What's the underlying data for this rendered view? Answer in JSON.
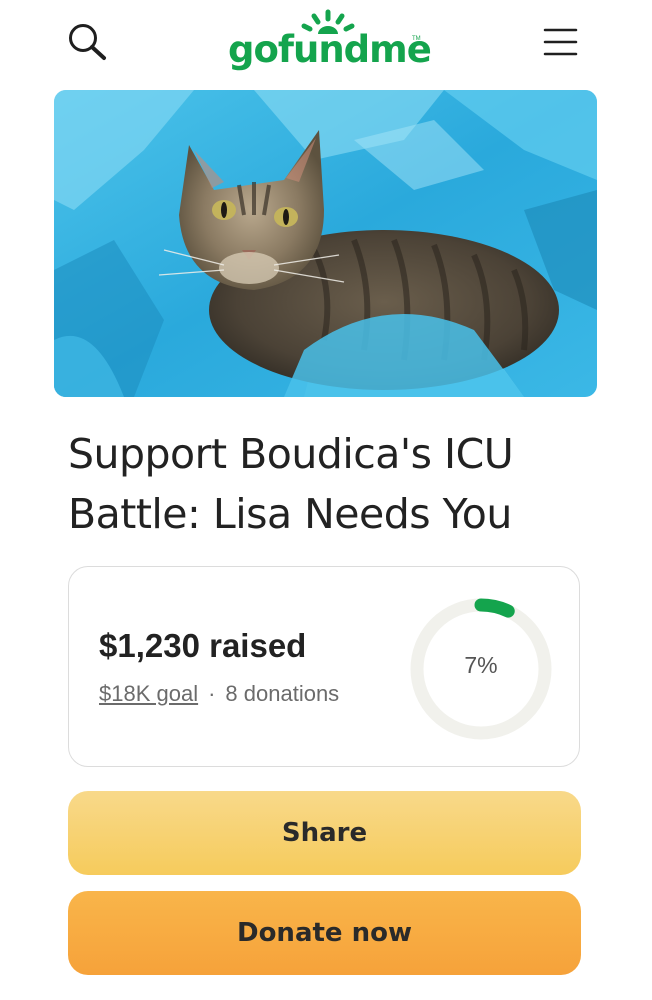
{
  "header": {
    "logo_text": "gofundme",
    "logo_tm": "TM",
    "brand_color": "#14a44d",
    "search_icon": "search-icon",
    "menu_icon": "hamburger-menu-icon"
  },
  "hero": {
    "image": "cat-photo"
  },
  "campaign": {
    "title": "Support Boudica's ICU Battle: Lisa Needs You"
  },
  "progress": {
    "raised_text": "$1,230 raised",
    "goal_text": "$18K goal",
    "separator": "·",
    "donations_text": "8 donations",
    "percent_text": "7%",
    "percent_value": 0.07,
    "ring_color": "#14a44d",
    "track_color": "#f1f1ec"
  },
  "actions": {
    "share_label": "Share",
    "donate_label": "Donate now"
  }
}
